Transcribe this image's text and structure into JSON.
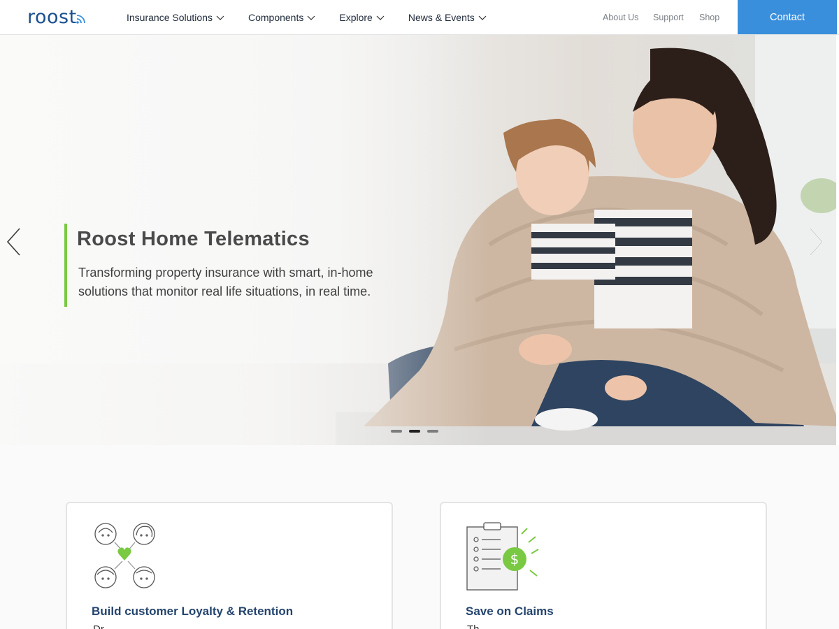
{
  "brand": {
    "logo_text": "roost",
    "accent": "#3a8fdd",
    "logo_color": "#1b4f8f",
    "green": "#7ac943"
  },
  "nav": {
    "menu": [
      {
        "label": "Insurance Solutions"
      },
      {
        "label": "Components"
      },
      {
        "label": "Explore"
      },
      {
        "label": "News & Events"
      }
    ],
    "utility": {
      "about": "About Us",
      "support": "Support",
      "shop": "Shop"
    },
    "contact": "Contact"
  },
  "hero": {
    "title": "Roost Home Telematics",
    "subtitle": "Transforming property insurance with smart, in-home solutions that monitor real life situations, in real time.",
    "slide_count": 3,
    "active_slide": 2,
    "icons": {
      "prev": "chevron-left-icon",
      "next": "chevron-right-icon"
    }
  },
  "features": [
    {
      "title": "Build customer Loyalty & Retention",
      "text": "Dr...",
      "icon": "people-heart-icon"
    },
    {
      "title": "Save on Claims",
      "text": "Th...",
      "icon": "clipboard-dollar-icon"
    }
  ]
}
